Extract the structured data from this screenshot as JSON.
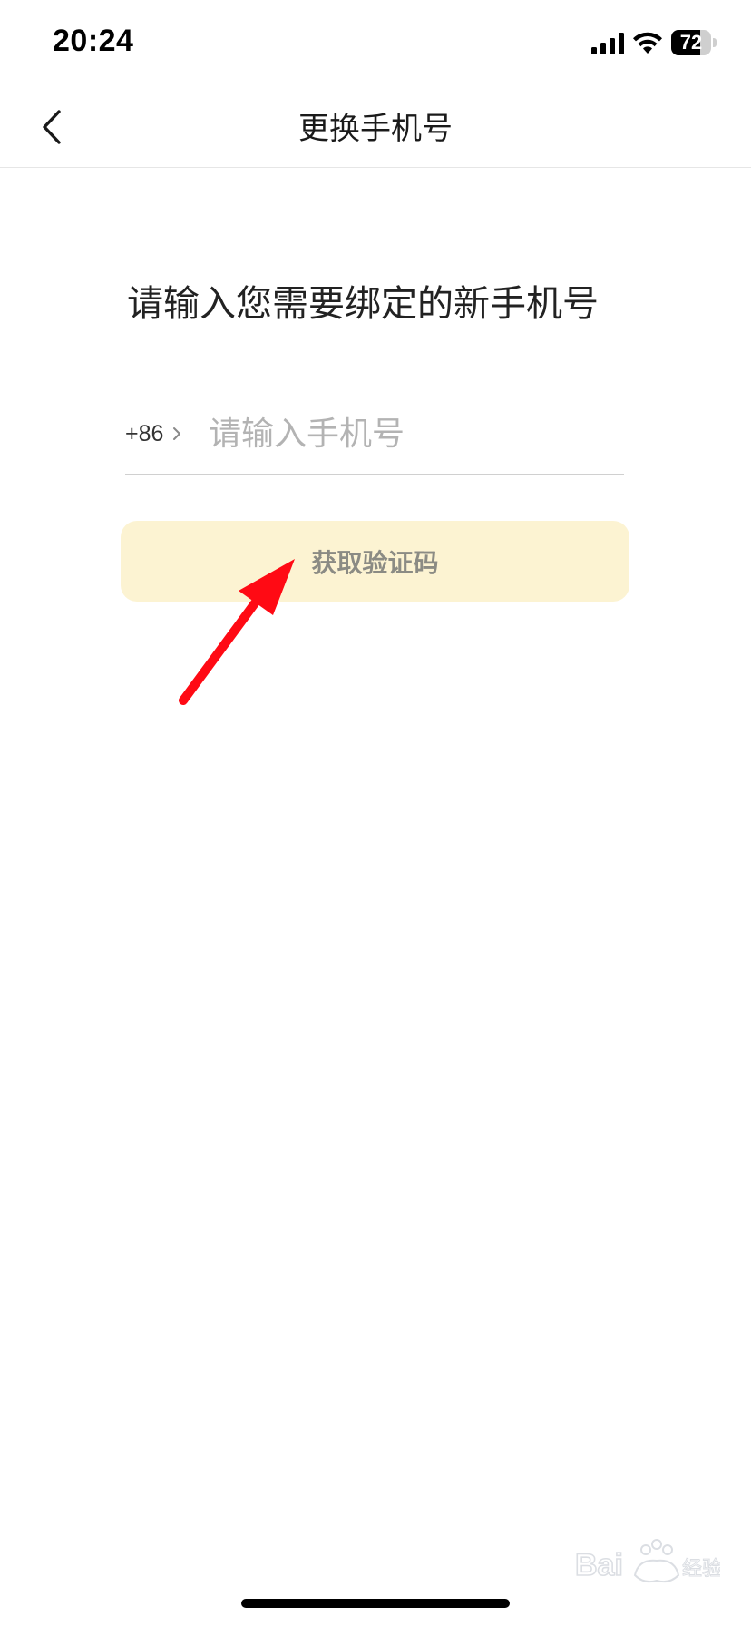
{
  "status_bar": {
    "time": "20:24",
    "battery_text": "72",
    "battery_level": 0.72
  },
  "nav": {
    "title": "更换手机号",
    "back_icon": "chevron-left-icon"
  },
  "prompt": "请输入您需要绑定的新手机号",
  "phone": {
    "country_code": "+86",
    "placeholder": "请输入手机号",
    "value": ""
  },
  "code_button": {
    "label": "获取验证码"
  },
  "annotation": {
    "icon": "red-arrow-icon",
    "color": "#ff0a14"
  },
  "watermark": {
    "icon": "baidu-jingyan-logo",
    "text": "Baidu 经验"
  },
  "colors": {
    "button_bg": "#fcf3d2",
    "button_text": "#8b8b84",
    "placeholder": "#b3b3b3",
    "divider": "#d0d0d0"
  }
}
